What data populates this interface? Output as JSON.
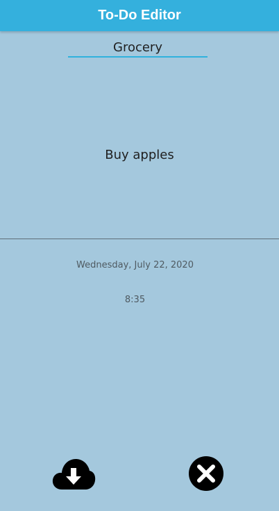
{
  "header": {
    "title": "To-Do Editor"
  },
  "editor": {
    "category": "Grocery",
    "task": "Buy apples",
    "date": "Wednesday, July 22, 2020",
    "time": "8:35"
  },
  "actions": {
    "save_icon": "cloud-download-icon",
    "cancel_icon": "close-circle-icon"
  },
  "colors": {
    "app_bar": "#34b0dd",
    "background": "#a4c8dd",
    "accent_underline": "#2fb2dd",
    "icon": "#000000"
  }
}
